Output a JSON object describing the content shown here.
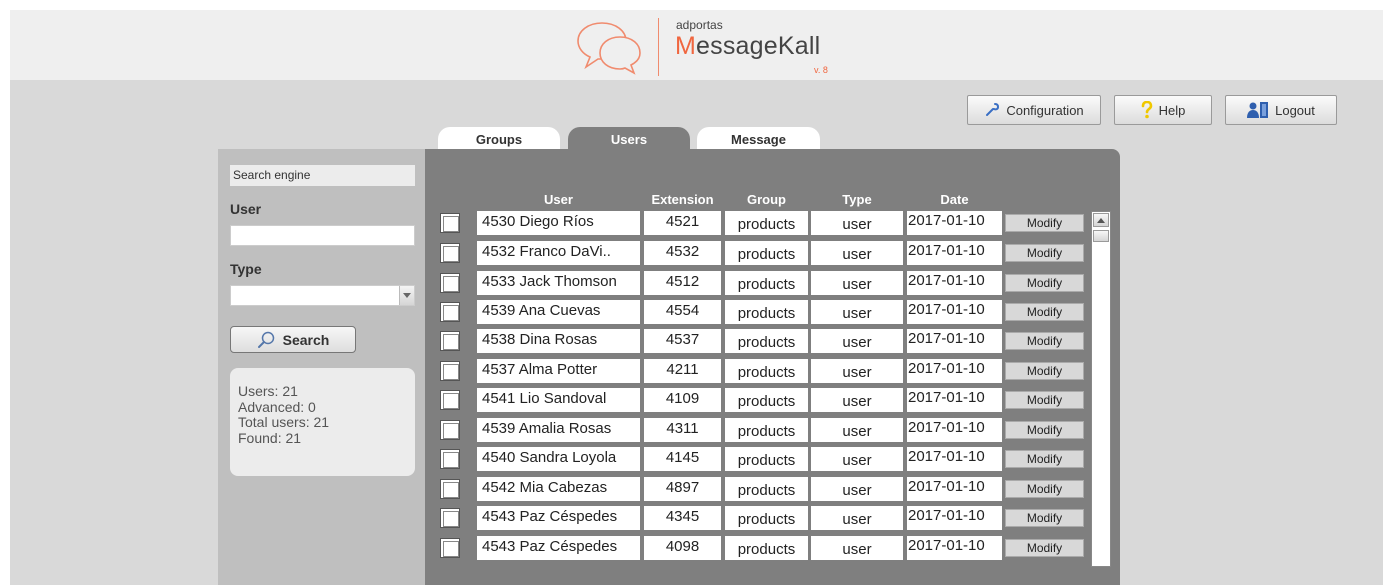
{
  "header": {
    "brand_small": "adportas",
    "brand_initial": "M",
    "brand_rest": "essageKall",
    "version": "v. 8"
  },
  "top_buttons": {
    "configuration": "Configuration",
    "help": "Help",
    "logout": "Logout"
  },
  "tabs": [
    {
      "label": "Groups",
      "active": false
    },
    {
      "label": "Users",
      "active": true
    },
    {
      "label": "Message",
      "active": false
    }
  ],
  "sidebar": {
    "title": "Search engine",
    "user_label": "User",
    "user_value": "",
    "type_label": "Type",
    "type_value": "",
    "search_label": "Search",
    "stats": [
      "Users: 21",
      "Advanced: 0",
      "Total users: 21",
      "Found: 21"
    ]
  },
  "table": {
    "headers": {
      "user": "User",
      "extension": "Extension",
      "group": "Group",
      "type": "Type",
      "date": "Date"
    },
    "modify_label": "Modify",
    "rows": [
      {
        "user": "4530 Diego Ríos",
        "extension": "4521",
        "group": "products",
        "type": "user",
        "date": "2017-01-10"
      },
      {
        "user": "4532 Franco DaVi..",
        "extension": "4532",
        "group": "products",
        "type": "user",
        "date": "2017-01-10"
      },
      {
        "user": "4533 Jack Thomson",
        "extension": "4512",
        "group": "products",
        "type": "user",
        "date": "2017-01-10"
      },
      {
        "user": "4539 Ana Cuevas",
        "extension": "4554",
        "group": "products",
        "type": "user",
        "date": "2017-01-10"
      },
      {
        "user": "4538 Dina Rosas",
        "extension": "4537",
        "group": "products",
        "type": "user",
        "date": "2017-01-10"
      },
      {
        "user": "4537 Alma Potter",
        "extension": "4211",
        "group": "products",
        "type": "user",
        "date": "2017-01-10"
      },
      {
        "user": "4541 Lio Sandoval",
        "extension": "4109",
        "group": "products",
        "type": "user",
        "date": "2017-01-10"
      },
      {
        "user": "4539 Amalia Rosas",
        "extension": "4311",
        "group": "products",
        "type": "user",
        "date": "2017-01-10"
      },
      {
        "user": "4540 Sandra Loyola",
        "extension": "4145",
        "group": "products",
        "type": "user",
        "date": "2017-01-10"
      },
      {
        "user": "4542 Mia Cabezas",
        "extension": "4897",
        "group": "products",
        "type": "user",
        "date": "2017-01-10"
      },
      {
        "user": "4543 Paz Céspedes",
        "extension": "4345",
        "group": "products",
        "type": "user",
        "date": "2017-01-10"
      },
      {
        "user": "4543 Paz Céspedes",
        "extension": "4098",
        "group": "products",
        "type": "user",
        "date": "2017-01-10"
      }
    ]
  },
  "colors": {
    "brand_orange": "#f0663f",
    "panel_gray": "#7f7f7f",
    "sidebar_gray": "#bfbfbf",
    "background_gray": "#d9d9d9"
  },
  "icons": {
    "logo": "chat-bubbles-icon",
    "configuration": "wrench-icon",
    "help": "question-mark-icon",
    "logout": "logout-user-icon",
    "search": "magnifier-icon",
    "select_arrow": "chevron-down-icon",
    "scroll_up": "arrow-up-icon"
  }
}
